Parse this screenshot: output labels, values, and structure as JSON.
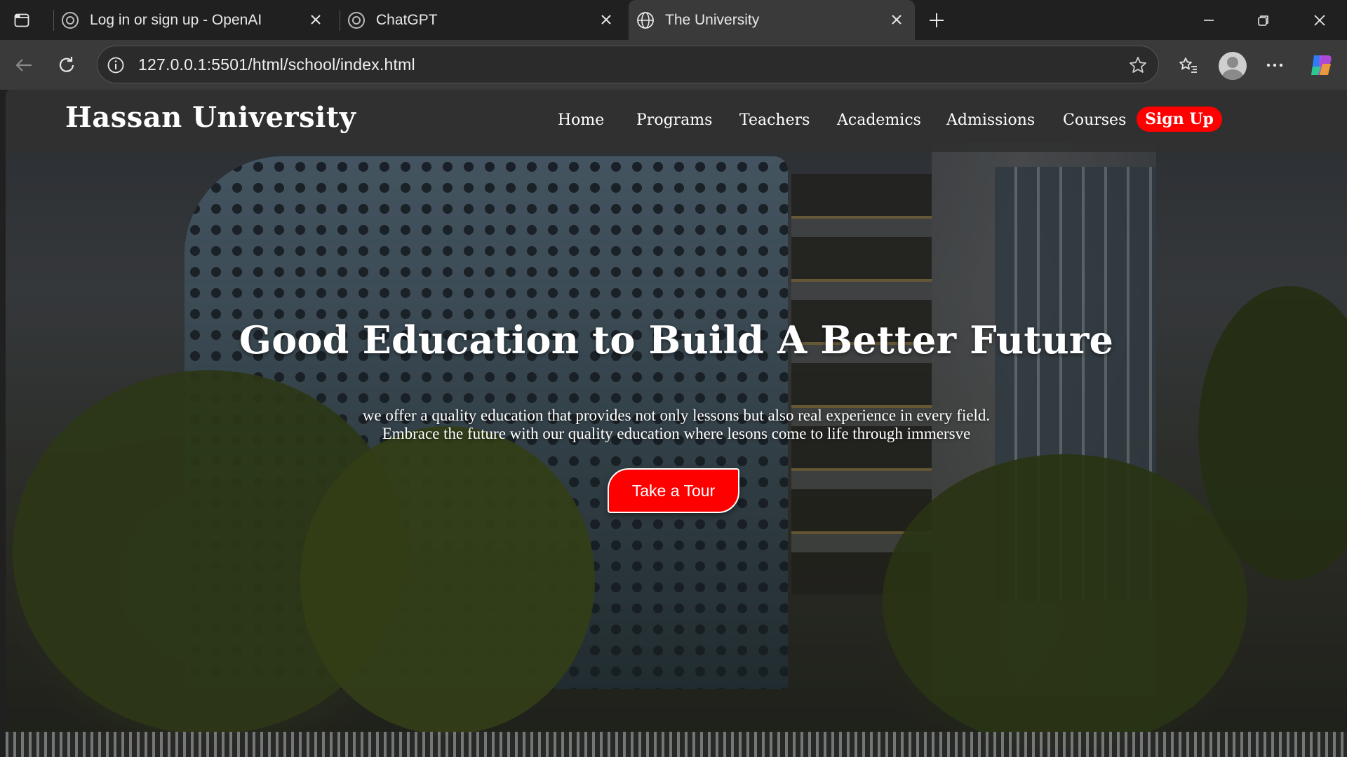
{
  "browser": {
    "tabs": [
      {
        "title": "Log in or sign up - OpenAI",
        "icon": "openai-icon"
      },
      {
        "title": "ChatGPT",
        "icon": "openai-icon"
      },
      {
        "title": "The University",
        "icon": "globe-icon",
        "active": true
      }
    ],
    "url": "127.0.0.1:5501/html/school/index.html"
  },
  "site": {
    "brand": "Hassan University",
    "nav": {
      "home": "Home",
      "programs": "Programs",
      "teachers": "Teachers",
      "academics": "Academics",
      "admissions": "Admissions",
      "courses": "Courses",
      "signup": "Sign Up"
    },
    "hero": {
      "title": "Good Education to Build A Better Future",
      "subtitle_line1": "we offer a quality education that provides not only lessons but also real experience in every field.",
      "subtitle_line2": "Embrace the future with our quality education where lesons come to life through immersve",
      "cta": "Take a Tour"
    }
  },
  "colors": {
    "accent": "#ff0000",
    "nav_bg": "#303030",
    "chrome_bg": "#202020"
  }
}
